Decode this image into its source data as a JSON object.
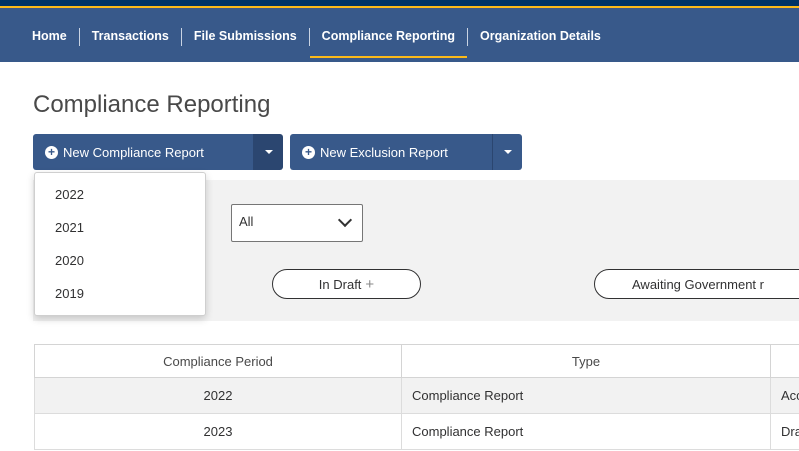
{
  "nav": {
    "items": [
      {
        "label": "Home",
        "active": false
      },
      {
        "label": "Transactions",
        "active": false
      },
      {
        "label": "File Submissions",
        "active": false
      },
      {
        "label": "Compliance Reporting",
        "active": true
      },
      {
        "label": "Organization Details",
        "active": false
      }
    ]
  },
  "page": {
    "title": "Compliance Reporting"
  },
  "buttons": {
    "new_compliance_report": "New Compliance Report",
    "new_exclusion_report": "New Exclusion Report"
  },
  "dropdown": {
    "years": [
      "2022",
      "2021",
      "2020",
      "2019"
    ]
  },
  "filter": {
    "select_value": "All",
    "status_pills": [
      {
        "label": "In Draft"
      },
      {
        "label": "Awaiting Government r"
      }
    ]
  },
  "table": {
    "headers": [
      "Compliance Period",
      "Type",
      ""
    ],
    "rows": [
      {
        "period": "2022",
        "type": "Compliance Report",
        "status": "Acc"
      },
      {
        "period": "2023",
        "type": "Compliance Report",
        "status": "Dra"
      }
    ]
  },
  "colors": {
    "nav_bg": "#38598a",
    "header_band": "#003366",
    "accent": "#fcba19",
    "button": "#38598a"
  },
  "icons": {
    "plus_circle": "plus-circle-icon",
    "caret": "caret-down-icon",
    "select_chevron": "chevron-down-icon"
  }
}
